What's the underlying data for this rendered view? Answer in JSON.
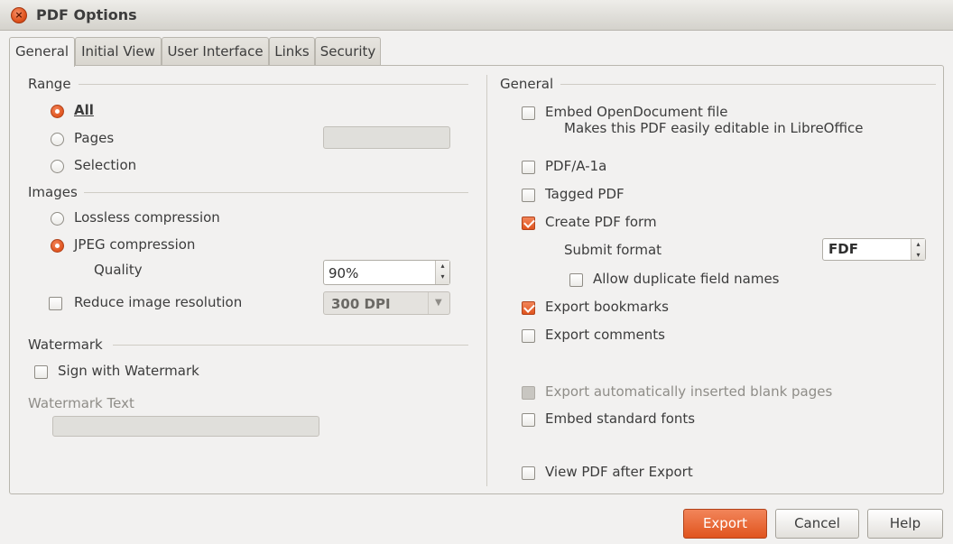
{
  "window": {
    "title": "PDF Options"
  },
  "tabs": [
    {
      "label": "General",
      "active": true
    },
    {
      "label": "Initial View",
      "active": false
    },
    {
      "label": "User Interface",
      "active": false
    },
    {
      "label": "Links",
      "active": false
    },
    {
      "label": "Security",
      "active": false
    }
  ],
  "range": {
    "title": "Range",
    "all": {
      "label": "All",
      "selected": true
    },
    "pages": {
      "label": "Pages",
      "selected": false,
      "value": ""
    },
    "selection": {
      "label": "Selection",
      "selected": false
    }
  },
  "images": {
    "title": "Images",
    "lossless": {
      "label": "Lossless compression",
      "selected": false
    },
    "jpeg": {
      "label": "JPEG compression",
      "selected": true
    },
    "quality": {
      "label": "Quality",
      "value": "90%"
    },
    "reduce": {
      "label": "Reduce image resolution",
      "checked": false,
      "value": "300 DPI"
    }
  },
  "watermark": {
    "title": "Watermark",
    "sign": {
      "label": "Sign with Watermark",
      "checked": false
    },
    "text_label": "Watermark Text",
    "text_value": ""
  },
  "general": {
    "title": "General",
    "embed_odf": {
      "label": "Embed OpenDocument file",
      "checked": false,
      "hint": "Makes this PDF easily editable in LibreOffice"
    },
    "pdfa": {
      "label": "PDF/A-1a",
      "checked": false
    },
    "tagged": {
      "label": "Tagged PDF",
      "checked": false
    },
    "create_form": {
      "label": "Create PDF form",
      "checked": true
    },
    "submit_format": {
      "label": "Submit format",
      "value": "FDF"
    },
    "allow_duplicate": {
      "label": "Allow duplicate field names",
      "checked": false
    },
    "export_bookmarks": {
      "label": "Export bookmarks",
      "checked": true
    },
    "export_comments": {
      "label": "Export comments",
      "checked": false
    },
    "export_blank": {
      "label": "Export automatically inserted blank pages",
      "checked": false,
      "disabled": true
    },
    "embed_fonts": {
      "label": "Embed standard fonts",
      "checked": false
    },
    "view_after": {
      "label": "View PDF after Export",
      "checked": false
    }
  },
  "buttons": {
    "export": "Export",
    "cancel": "Cancel",
    "help": "Help"
  },
  "colors": {
    "accent": "#e0541e",
    "dialog_bg": "#f2f1f0",
    "text": "#3c3c3c"
  }
}
